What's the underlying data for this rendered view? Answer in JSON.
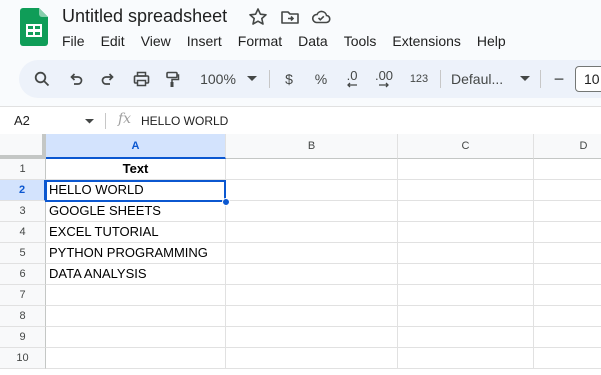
{
  "app": {
    "title": "Untitled spreadsheet",
    "icons": [
      "sheets-logo",
      "star-icon",
      "move-folder-icon",
      "cloud-saved-icon"
    ]
  },
  "menu": [
    "File",
    "Edit",
    "View",
    "Insert",
    "Format",
    "Data",
    "Tools",
    "Extensions",
    "Help"
  ],
  "toolbar": {
    "zoom": "100%",
    "currency_label": "$",
    "percent_label": "%",
    "decrease_decimal_label": ".0",
    "increase_decimal_label": ".00",
    "more_formats_label": "123",
    "font": "Defaul...",
    "decrease_font_label": "−",
    "font_size": "10"
  },
  "formula_bar": {
    "name_box": "A2",
    "fx_label": "fx",
    "value": "HELLO WORLD"
  },
  "grid": {
    "columns": [
      "A",
      "B",
      "C",
      "D"
    ],
    "rows": [
      "1",
      "2",
      "3",
      "4",
      "5",
      "6",
      "7",
      "8",
      "9",
      "10"
    ],
    "cells_A": [
      "Text",
      "HELLO WORLD",
      "GOOGLE SHEETS",
      "EXCEL TUTORIAL",
      "PYTHON PROGRAMMING",
      "DATA ANALYSIS",
      "",
      "",
      "",
      ""
    ],
    "active_cell": "A2"
  },
  "colors": {
    "accent": "#0b57d0",
    "selected_header": "#d3e3fd",
    "logo_green": "#0f9d58",
    "toolbar_bg": "#edf2fa"
  }
}
